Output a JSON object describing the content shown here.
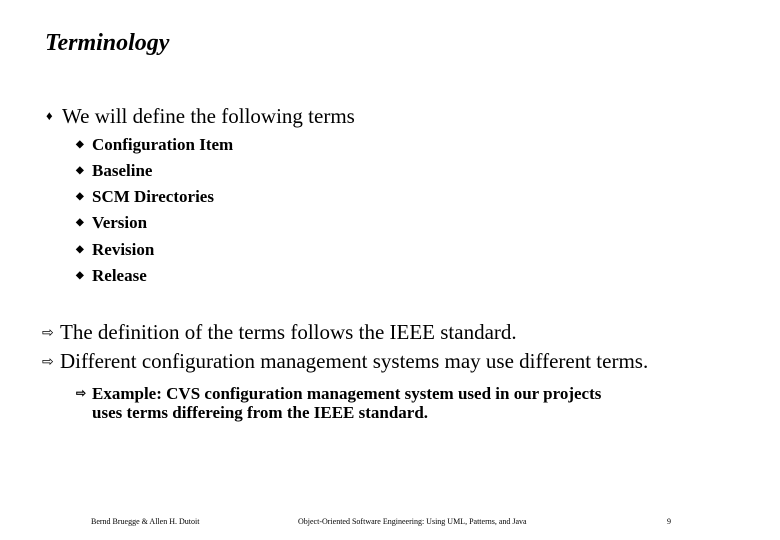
{
  "slide": {
    "title": "Terminology",
    "intro": "We will define the following terms",
    "terms": [
      "Configuration Item",
      "Baseline",
      "SCM Directories",
      "Version",
      "Revision",
      "Release"
    ],
    "points": [
      "The definition of the terms follows the IEEE standard.",
      "Different configuration management systems may use different terms."
    ],
    "example_line1": "Example:  CVS configuration management system used in our projects",
    "example_line2": "uses terms differeing from the IEEE standard."
  },
  "icons": {
    "diamond": "♦",
    "small_diamond": "◆",
    "arrow": "⇨"
  },
  "footer": {
    "authors": "Bernd Bruegge & Allen H. Dutoit",
    "book": "Object-Oriented Software Engineering: Using UML, Patterns, and Java",
    "page": "9"
  }
}
